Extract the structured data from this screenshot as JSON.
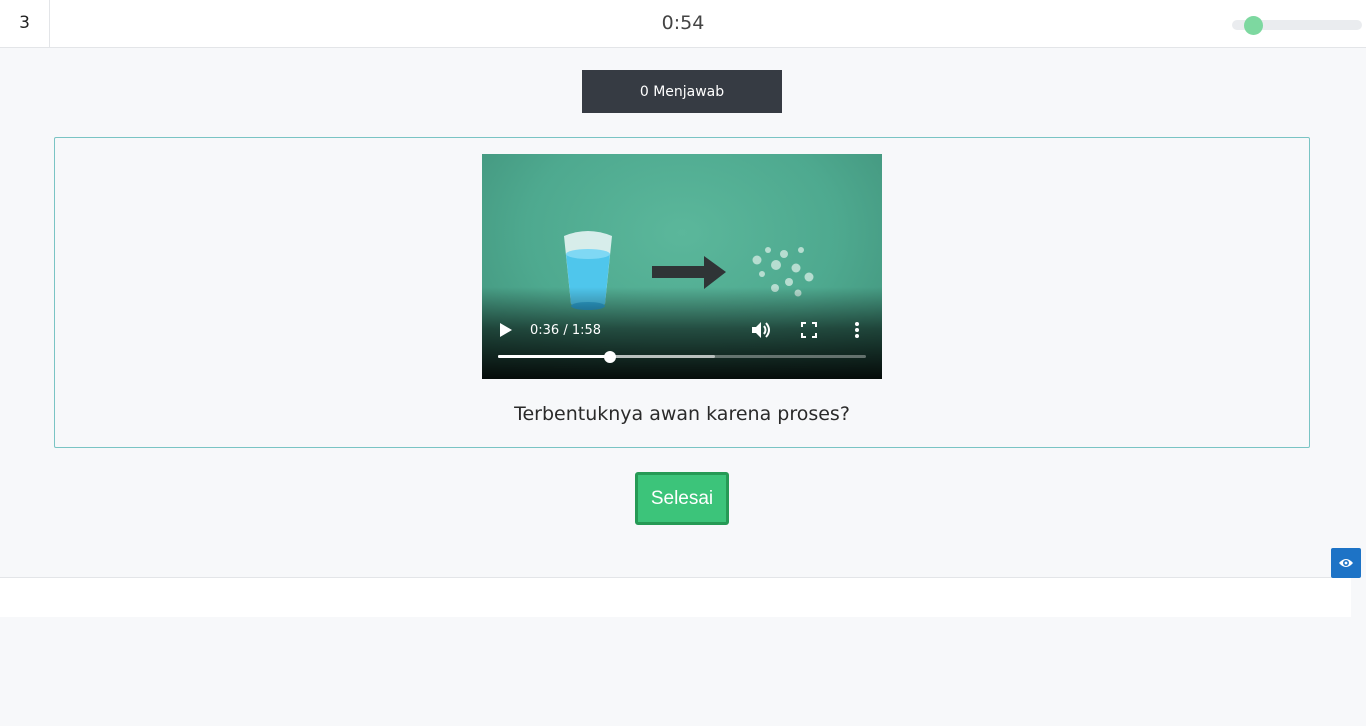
{
  "header": {
    "question_number": "3",
    "timer": "0:54",
    "timer_slider_level": 0.1
  },
  "answered_label": "0 Menjawab",
  "video": {
    "time_display": "0:36 / 1:58",
    "progress_fraction": 0.305,
    "icons": {
      "play": "play-icon",
      "volume": "volume-icon",
      "fullscreen": "fullscreen-icon",
      "more": "more-vertical-icon"
    }
  },
  "question": {
    "text": "Terbentuknya awan karena proses?"
  },
  "finish_button_label": "Selesai",
  "floating": {
    "eye_icon": "eye-icon"
  },
  "colors": {
    "finish_green": "#3cc47a",
    "dark_badge": "#363b43",
    "card_border": "#7ac4c4",
    "eye_button_blue": "#1d73c6",
    "slider_knob": "#7dd8a0"
  }
}
